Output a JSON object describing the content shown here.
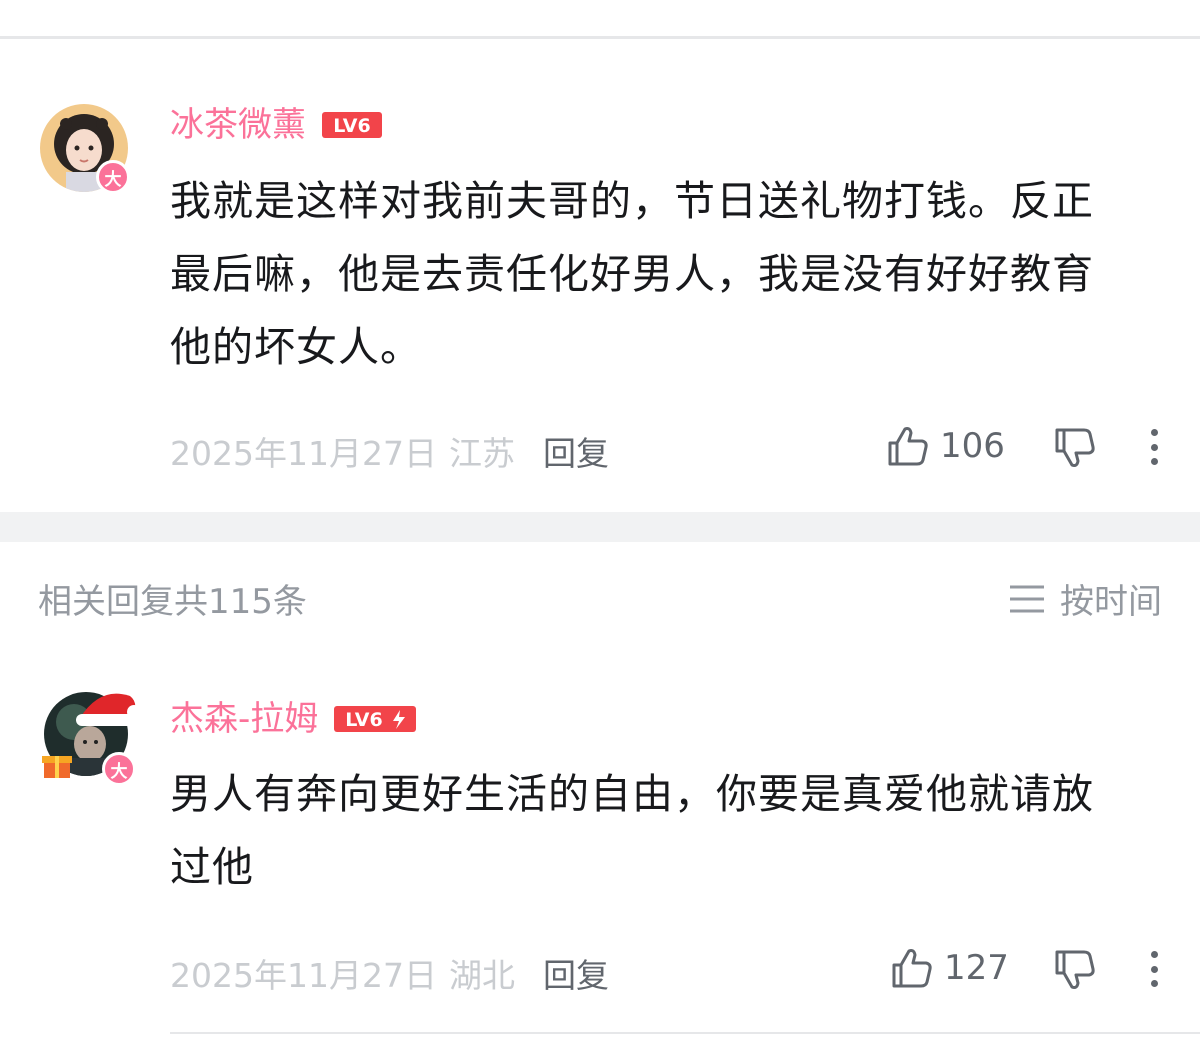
{
  "comments": [
    {
      "username": "冰茶微薰",
      "level": "LV6",
      "badge": "大",
      "text_lines": [
        "我就是这样对我前夫哥的，节日送礼物打钱。反正",
        "最后嘛，他是去责任化好男人，我是没有好好教育",
        "他的坏女人。"
      ],
      "date": "2025年11月27日",
      "location": "江苏",
      "reply_label": "回复",
      "likes": "106"
    },
    {
      "username": "杰森-拉姆",
      "level": "LV6",
      "badge": "大",
      "text_lines": [
        "男人有奔向更好生活的自由，你要是真爱他就请放",
        "过他"
      ],
      "date": "2025年11月27日",
      "location": "湖北",
      "reply_label": "回复",
      "likes": "127"
    }
  ],
  "replies_header": "相关回复共115条",
  "sort_label": "按时间",
  "colors": {
    "username": "#fb7299",
    "level_badge": "#f2444a",
    "meta_light": "#c9ccd0",
    "meta_dark": "#61666d",
    "section_gap": "#f1f2f3"
  },
  "icons": {
    "like": "thumb-up-icon",
    "dislike": "thumb-down-icon",
    "more": "more-vertical-icon",
    "sort": "menu-lines-icon"
  }
}
